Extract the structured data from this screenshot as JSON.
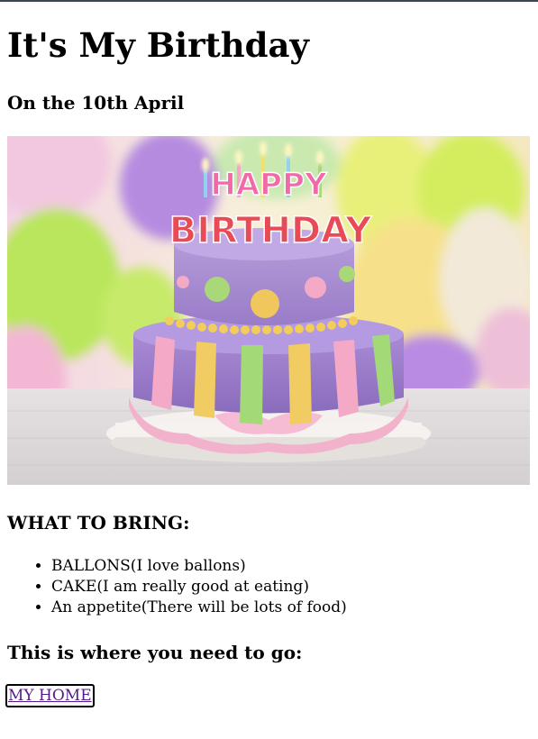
{
  "page": {
    "title": "It's My Birthday",
    "subtitle": "On the 10th April"
  },
  "hero_image": {
    "caption_text": [
      "HAPPY",
      "BIRTHDAY"
    ]
  },
  "bring": {
    "heading": "WHAT TO BRING:",
    "items": [
      "BALLONS(I love ballons)",
      "CAKE(I am really good at eating)",
      "An appetite(There will be lots of food)"
    ]
  },
  "directions": {
    "heading": "This is where you need to go:",
    "link_label": "MY HOME"
  }
}
